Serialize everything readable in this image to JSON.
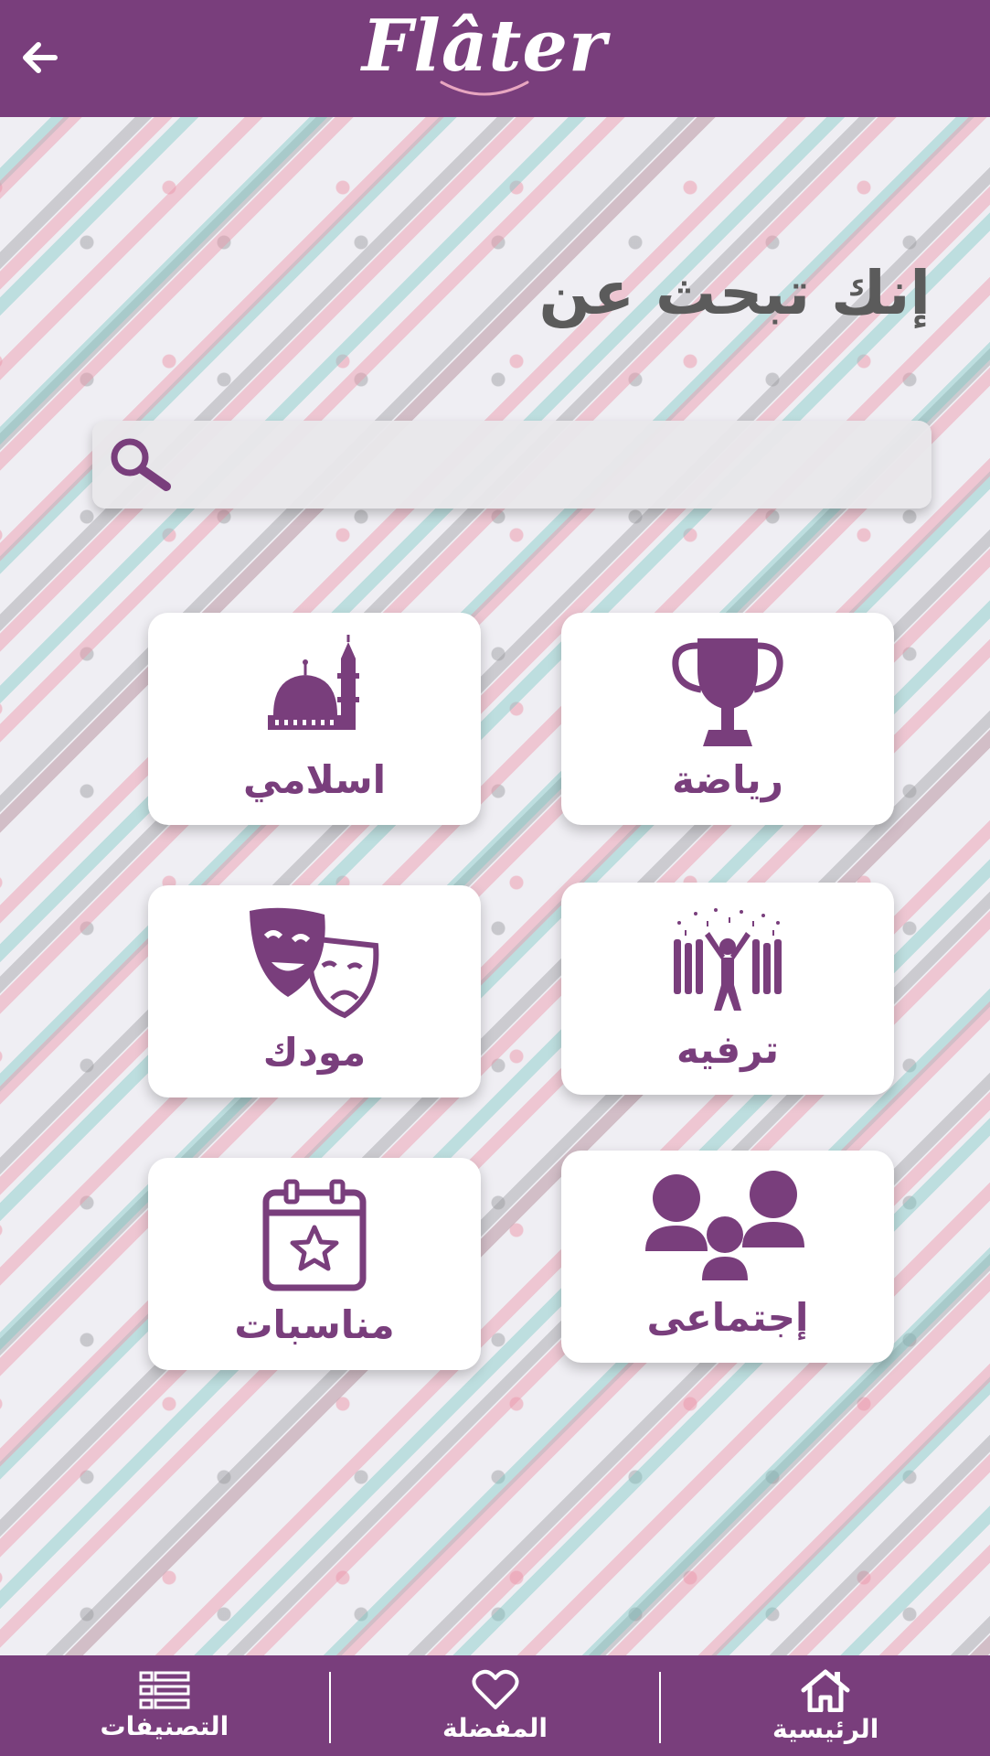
{
  "header": {
    "back_label": "←",
    "logo_text": "Flâter"
  },
  "main": {
    "title": "إنك تبحث عن",
    "search": {
      "placeholder": "",
      "value": ""
    }
  },
  "categories": [
    {
      "label": "رياضة",
      "icon": "trophy-icon"
    },
    {
      "label": "اسلامي",
      "icon": "mosque-icon"
    },
    {
      "label": "ترفيه",
      "icon": "party-crowd-icon"
    },
    {
      "label": "مودك",
      "icon": "theater-masks-icon"
    },
    {
      "label": "إجتماعى",
      "icon": "people-group-icon"
    },
    {
      "label": "مناسبات",
      "icon": "calendar-star-icon"
    }
  ],
  "bottom_nav": {
    "items": [
      {
        "label": "الرئيسية",
        "icon": "home-icon"
      },
      {
        "label": "المفضلة",
        "icon": "heart-icon"
      },
      {
        "label": "التصنيفات",
        "icon": "list-icon"
      }
    ]
  },
  "colors": {
    "primary": "#793e7c",
    "title_gray": "#5b5b5b",
    "card_bg": "#ffffff"
  }
}
